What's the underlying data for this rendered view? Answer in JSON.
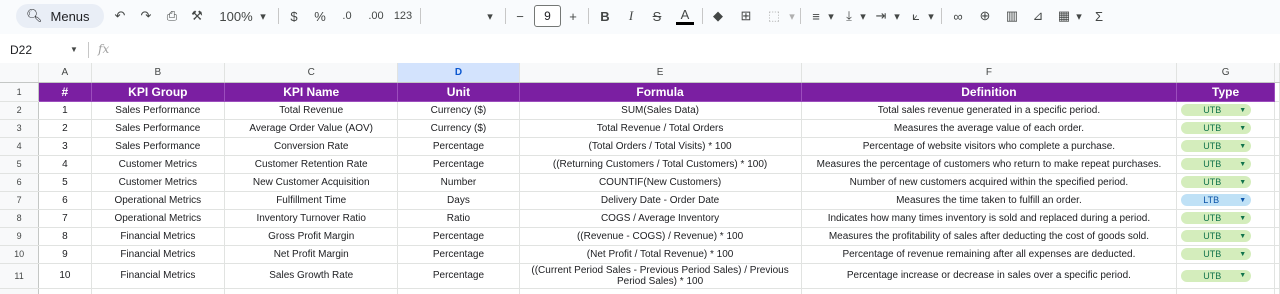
{
  "toolbar": {
    "menus_label": "Menus",
    "zoom": "100%",
    "currency_symbol": "$",
    "percent_symbol": "%",
    "decrease_decimal": ".0",
    "increase_decimal": ".00",
    "number_format": "123",
    "font_size": "9",
    "bold": "B",
    "italic": "I",
    "strike": "S",
    "text_color": "A",
    "sum": "Σ"
  },
  "formula_bar": {
    "cell_ref": "D22",
    "fx": "fx"
  },
  "columns": [
    "A",
    "B",
    "C",
    "D",
    "E",
    "F",
    "G"
  ],
  "selected_column": "D",
  "header_row": {
    "num": "#",
    "kpi_group": "KPI Group",
    "kpi_name": "KPI Name",
    "unit": "Unit",
    "formula": "Formula",
    "definition": "Definition",
    "type": "Type"
  },
  "rows": [
    {
      "row": "2",
      "num": "1",
      "group": "Sales Performance",
      "name": "Total Revenue",
      "unit": "Currency ($)",
      "formula": "SUM(Sales Data)",
      "definition": "Total sales revenue generated in a specific period.",
      "type": "UTB"
    },
    {
      "row": "3",
      "num": "2",
      "group": "Sales Performance",
      "name": "Average Order Value (AOV)",
      "unit": "Currency ($)",
      "formula": "Total Revenue / Total Orders",
      "definition": "Measures the average value of each order.",
      "type": "UTB"
    },
    {
      "row": "4",
      "num": "3",
      "group": "Sales Performance",
      "name": "Conversion Rate",
      "unit": "Percentage",
      "formula": "(Total Orders / Total Visits) * 100",
      "definition": "Percentage of website visitors who complete a purchase.",
      "type": "UTB"
    },
    {
      "row": "5",
      "num": "4",
      "group": "Customer Metrics",
      "name": "Customer Retention Rate",
      "unit": "Percentage",
      "formula": "((Returning Customers / Total Customers) * 100)",
      "definition": "Measures the percentage of customers who return to make repeat purchases.",
      "type": "UTB"
    },
    {
      "row": "6",
      "num": "5",
      "group": "Customer Metrics",
      "name": "New Customer Acquisition",
      "unit": "Number",
      "formula": "COUNTIF(New Customers)",
      "definition": "Number of new customers acquired within the specified period.",
      "type": "UTB"
    },
    {
      "row": "7",
      "num": "6",
      "group": "Operational Metrics",
      "name": "Fulfillment Time",
      "unit": "Days",
      "formula": "Delivery Date - Order Date",
      "definition": "Measures the time taken to fulfill an order.",
      "type": "LTB"
    },
    {
      "row": "8",
      "num": "7",
      "group": "Operational Metrics",
      "name": "Inventory Turnover Ratio",
      "unit": "Ratio",
      "formula": "COGS / Average Inventory",
      "definition": "Indicates how many times inventory is sold and replaced during a period.",
      "type": "UTB"
    },
    {
      "row": "9",
      "num": "8",
      "group": "Financial Metrics",
      "name": "Gross Profit Margin",
      "unit": "Percentage",
      "formula": "((Revenue - COGS) / Revenue) * 100",
      "definition": "Measures the profitability of sales after deducting the cost of goods sold.",
      "type": "UTB"
    },
    {
      "row": "10",
      "num": "9",
      "group": "Financial Metrics",
      "name": "Net Profit Margin",
      "unit": "Percentage",
      "formula": "(Net Profit / Total Revenue) * 100",
      "definition": "Percentage of revenue remaining after all expenses are deducted.",
      "type": "UTB"
    },
    {
      "row": "11",
      "num": "10",
      "group": "Financial Metrics",
      "name": "Sales Growth Rate",
      "unit": "Percentage",
      "formula": "((Current Period Sales - Previous Period Sales) / Previous Period Sales) * 100",
      "definition": "Percentage increase or decrease in sales over a specific period.",
      "type": "UTB"
    }
  ],
  "colors": {
    "header_bg": "#7b1fa2",
    "utb_chip": "#d4edbc",
    "ltb_chip": "#bfe1f6"
  }
}
